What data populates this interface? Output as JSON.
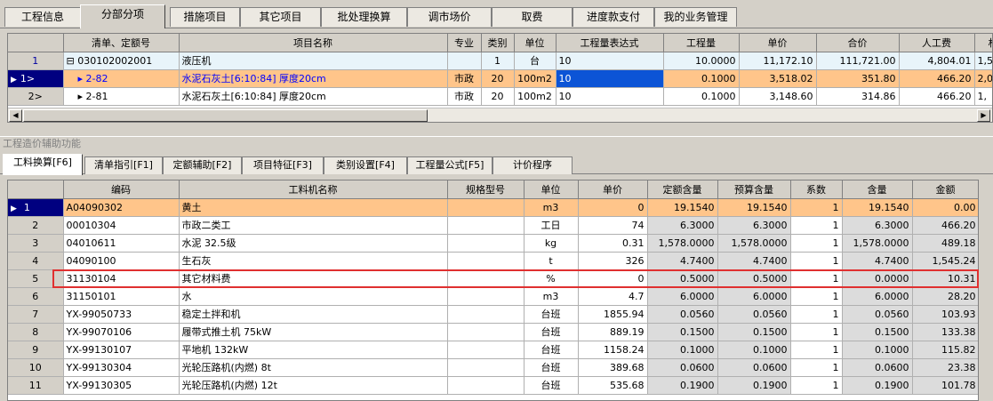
{
  "top_tabs": [
    "工程信息",
    "分部分项",
    "措施项目",
    "其它项目",
    "批处理换算",
    "调市场价",
    "取费",
    "进度款支付",
    "我的业务管理"
  ],
  "upper_grid": {
    "headers": [
      "",
      "清单、定额号",
      "项目名称",
      "专业",
      "类别",
      "单位",
      "工程量表达式",
      "工程量",
      "单价",
      "合价",
      "人工费",
      "材料"
    ],
    "rows": [
      {
        "rn": "1",
        "code": "⊟ 030102002001",
        "name": "液压机",
        "major": "",
        "cat": "1",
        "unit": "台",
        "expr": "10",
        "qty": "10.0000",
        "price": "11,172.10",
        "total": "111,721.00",
        "labor": "4,804.01",
        "mat": "1,5"
      },
      {
        "rn": "1>",
        "code": "▸ 2-82",
        "name": "水泥石灰土[6:10:84] 厚度20cm",
        "major": "市政",
        "cat": "20",
        "unit": "100m2",
        "expr": "10",
        "qty": "0.1000",
        "price": "3,518.02",
        "total": "351.80",
        "labor": "466.20",
        "mat": "2,0"
      },
      {
        "rn": "2>",
        "code": "▸ 2-81",
        "name": "水泥石灰土[6:10:84] 厚度20cm",
        "major": "市政",
        "cat": "20",
        "unit": "100m2",
        "expr": "10",
        "qty": "0.1000",
        "price": "3,148.60",
        "total": "314.86",
        "labor": "466.20",
        "mat": "1,"
      }
    ]
  },
  "section_title": "工程造价辅助功能",
  "bottom_tabs": [
    "工料换算[F6]",
    "清单指引[F1]",
    "定额辅助[F2]",
    "项目特征[F3]",
    "类别设置[F4]",
    "工程量公式[F5]",
    "计价程序"
  ],
  "lower_grid": {
    "headers": [
      "",
      "编码",
      "工料机名称",
      "规格型号",
      "单位",
      "单价",
      "定额含量",
      "预算含量",
      "系数",
      "含量",
      "金额"
    ],
    "rows": [
      {
        "rn": "1",
        "code": "A04090302",
        "name": "黄土",
        "spec": "",
        "unit": "m3",
        "price": "0",
        "quota": "19.1540",
        "budget": "19.1540",
        "coef": "1",
        "content": "19.1540",
        "amount": "0.00"
      },
      {
        "rn": "2",
        "code": "00010304",
        "name": "市政二类工",
        "spec": "",
        "unit": "工日",
        "price": "74",
        "quota": "6.3000",
        "budget": "6.3000",
        "coef": "1",
        "content": "6.3000",
        "amount": "466.20"
      },
      {
        "rn": "3",
        "code": "04010611",
        "name": "水泥 32.5级",
        "spec": "",
        "unit": "kg",
        "price": "0.31",
        "quota": "1,578.0000",
        "budget": "1,578.0000",
        "coef": "1",
        "content": "1,578.0000",
        "amount": "489.18"
      },
      {
        "rn": "4",
        "code": "04090100",
        "name": "生石灰",
        "spec": "",
        "unit": "t",
        "price": "326",
        "quota": "4.7400",
        "budget": "4.7400",
        "coef": "1",
        "content": "4.7400",
        "amount": "1,545.24"
      },
      {
        "rn": "5",
        "code": "31130104",
        "name": "其它材料费",
        "spec": "",
        "unit": "%",
        "price": "0",
        "quota": "0.5000",
        "budget": "0.5000",
        "coef": "1",
        "content": "0.0000",
        "amount": "10.31"
      },
      {
        "rn": "6",
        "code": "31150101",
        "name": "水",
        "spec": "",
        "unit": "m3",
        "price": "4.7",
        "quota": "6.0000",
        "budget": "6.0000",
        "coef": "1",
        "content": "6.0000",
        "amount": "28.20"
      },
      {
        "rn": "7",
        "code": "YX-99050733",
        "name": "稳定土拌和机",
        "spec": "",
        "unit": "台班",
        "price": "1855.94",
        "quota": "0.0560",
        "budget": "0.0560",
        "coef": "1",
        "content": "0.0560",
        "amount": "103.93"
      },
      {
        "rn": "8",
        "code": "YX-99070106",
        "name": "履带式推土机  75kW",
        "spec": "",
        "unit": "台班",
        "price": "889.19",
        "quota": "0.1500",
        "budget": "0.1500",
        "coef": "1",
        "content": "0.1500",
        "amount": "133.38"
      },
      {
        "rn": "9",
        "code": "YX-99130107",
        "name": "平地机  132kW",
        "spec": "",
        "unit": "台班",
        "price": "1158.24",
        "quota": "0.1000",
        "budget": "0.1000",
        "coef": "1",
        "content": "0.1000",
        "amount": "115.82"
      },
      {
        "rn": "10",
        "code": "YX-99130304",
        "name": "光轮压路机(内燃)  8t",
        "spec": "",
        "unit": "台班",
        "price": "389.68",
        "quota": "0.0600",
        "budget": "0.0600",
        "coef": "1",
        "content": "0.0600",
        "amount": "23.38"
      },
      {
        "rn": "11",
        "code": "YX-99130305",
        "name": "光轮压路机(内燃)  12t",
        "spec": "",
        "unit": "台班",
        "price": "535.68",
        "quota": "0.1900",
        "budget": "0.1900",
        "coef": "1",
        "content": "0.1900",
        "amount": "101.78"
      }
    ]
  },
  "icons": {
    "row_pointer": "▶",
    "scroll_left": "◀",
    "scroll_right": "▶"
  }
}
